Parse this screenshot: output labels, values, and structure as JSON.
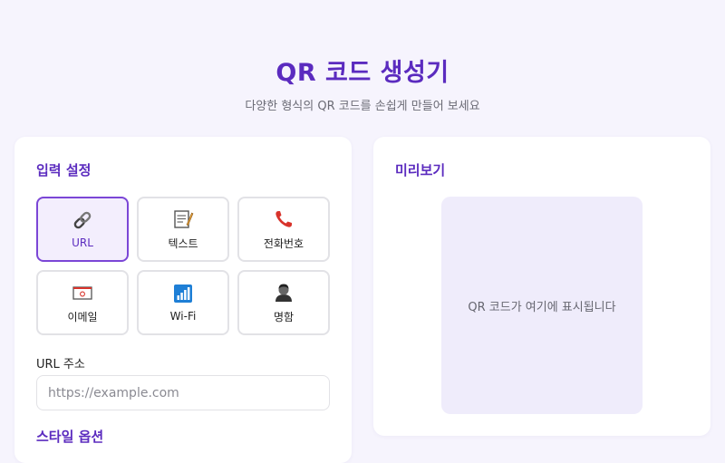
{
  "header": {
    "title": "QR 코드 생성기",
    "subtitle": "다양한 형식의 QR 코드를 손쉽게 만들어 보세요"
  },
  "input_panel": {
    "title": "입력 설정",
    "types": [
      {
        "label": "URL",
        "icon": "link-icon",
        "active": true
      },
      {
        "label": "텍스트",
        "icon": "memo-icon",
        "active": false
      },
      {
        "label": "전화번호",
        "icon": "phone-icon",
        "active": false
      },
      {
        "label": "이메일",
        "icon": "envelope-icon",
        "active": false
      },
      {
        "label": "Wi-Fi",
        "icon": "wifi-signal-icon",
        "active": false
      },
      {
        "label": "명함",
        "icon": "person-icon",
        "active": false
      }
    ],
    "url_label": "URL 주소",
    "url_placeholder": "https://example.com",
    "url_value": "",
    "style_title": "스타일 옵션"
  },
  "preview_panel": {
    "title": "미리보기",
    "placeholder": "QR 코드가 여기에 표시됩니다"
  },
  "colors": {
    "accent": "#5b2bbf",
    "active_border": "#7b46d6",
    "background": "#f6f4fd",
    "preview_bg": "#efecfb"
  }
}
